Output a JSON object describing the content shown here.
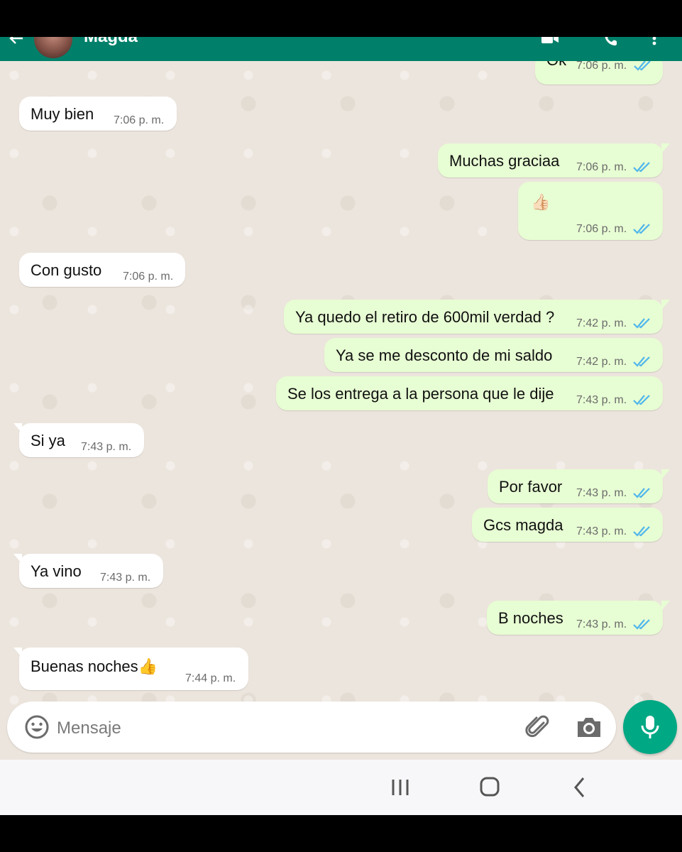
{
  "header": {
    "contact_name": "Magda",
    "colors": {
      "bar": "#00806a",
      "icons": "#ffffff"
    },
    "icons": [
      "back-arrow-icon",
      "video-call-icon",
      "phone-icon",
      "more-options-icon"
    ]
  },
  "messages": [
    {
      "direction": "out",
      "text": "Ok",
      "time": "7:06 p. m.",
      "status": "read"
    },
    {
      "direction": "in",
      "text": "Muy bien",
      "time": "7:06 p. m."
    },
    {
      "direction": "out",
      "text": "Muchas graciaa",
      "time": "7:06 p. m.",
      "status": "read"
    },
    {
      "direction": "out",
      "text": "👍🏻",
      "time": "7:06 p. m.",
      "status": "read"
    },
    {
      "direction": "in",
      "text": "Con gusto",
      "time": "7:06 p. m."
    },
    {
      "direction": "out",
      "text": "Ya quedo el retiro de 600mil verdad ?",
      "time": "7:42 p. m.",
      "status": "read"
    },
    {
      "direction": "out",
      "text": "Ya se me desconto de mi saldo",
      "time": "7:42 p. m.",
      "status": "read"
    },
    {
      "direction": "out",
      "text": "Se los entrega a la persona que le dije",
      "time": "7:43 p. m.",
      "status": "read"
    },
    {
      "direction": "in",
      "text": "Si ya",
      "time": "7:43 p. m."
    },
    {
      "direction": "out",
      "text": "Por favor",
      "time": "7:43 p. m.",
      "status": "read"
    },
    {
      "direction": "out",
      "text": "Gcs magda",
      "time": "7:43 p. m.",
      "status": "read"
    },
    {
      "direction": "in",
      "text": "Ya vino",
      "time": "7:43 p. m."
    },
    {
      "direction": "out",
      "text": "B noches",
      "time": "7:43 p. m.",
      "status": "read"
    },
    {
      "direction": "in",
      "text": "Buenas noches👍",
      "time": "7:44 p. m."
    }
  ],
  "composer": {
    "placeholder": "Mensaje",
    "icons": [
      "emoji-icon",
      "attach-icon",
      "camera-icon",
      "mic-icon"
    ],
    "mic_color": "#00a884"
  },
  "system_nav": {
    "buttons": [
      "recent-apps-icon",
      "home-icon",
      "back-icon"
    ]
  },
  "colors": {
    "chat_bg": "#ece5dd",
    "incoming_bubble": "#ffffff",
    "outgoing_bubble": "#e7fdd3",
    "read_ticks": "#4fb6ec"
  }
}
